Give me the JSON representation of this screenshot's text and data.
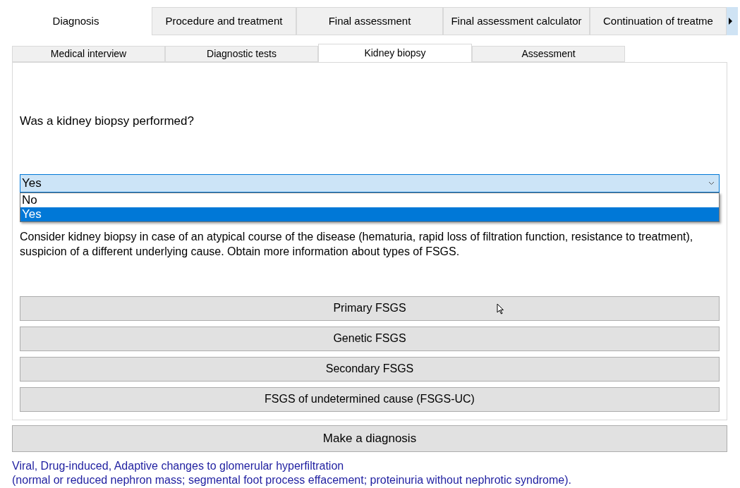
{
  "tabs": [
    {
      "label": "Diagnosis",
      "selected": true
    },
    {
      "label": "Procedure and treatment",
      "selected": false
    },
    {
      "label": "Final assessment",
      "selected": false
    },
    {
      "label": "Final assessment calculator",
      "selected": false
    },
    {
      "label": "Continuation of treatme",
      "selected": false
    }
  ],
  "subtabs": [
    {
      "label": "Medical interview",
      "selected": false
    },
    {
      "label": "Diagnostic tests",
      "selected": false
    },
    {
      "label": "Kidney biopsy",
      "selected": true
    },
    {
      "label": "Assessment",
      "selected": false
    }
  ],
  "question": "Was a kidney biopsy performed?",
  "combobox": {
    "value": "Yes",
    "expanded": true,
    "options": [
      {
        "label": "No",
        "selected": false
      },
      {
        "label": "Yes",
        "selected": true
      }
    ]
  },
  "info_text": "Consider kidney biopsy in case of an atypical course of the disease (hematuria, rapid loss of filtration function, resistance to treatment), suspicion of a different underlying cause. Obtain more information about types of FSGS.",
  "type_buttons": [
    "Primary FSGS",
    "Genetic FSGS",
    "Secondary FSGS",
    "FSGS of undetermined cause (FSGS-UC)"
  ],
  "diagnose_button": "Make a diagnosis",
  "result_lines": [
    "Viral, Drug-induced, Adaptive changes to glomerular hyperfiltration",
    "(normal or reduced nephron mass; segmental foot process effacement; proteinuria without nephrotic syndrome)."
  ]
}
